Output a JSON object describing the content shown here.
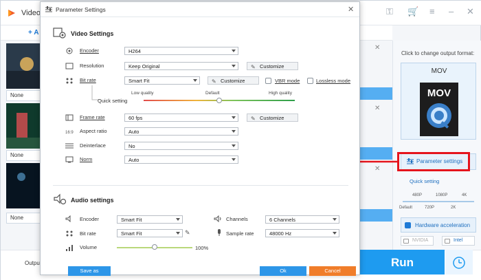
{
  "app": {
    "title": "Video",
    "add_label": "+ A",
    "thumb_labels": [
      "None",
      "None",
      "None"
    ],
    "output_label": "Output",
    "run_label": "Run"
  },
  "sidebar": {
    "format_hint": "Click to change output format:",
    "format_name": "MOV",
    "param_button": "Parameter settings",
    "quick_setting": "Quick setting",
    "quick_ticks_top": [
      "480P",
      "1080P",
      "4K"
    ],
    "quick_ticks_bottom": [
      "Default",
      "720P",
      "2K"
    ],
    "hw_accel": "Hardware acceleration",
    "gpu_nvidia": "NVIDIA",
    "gpu_intel": "Intel"
  },
  "dialog": {
    "title": "Parameter Settings",
    "video_section": "Video Settings",
    "audio_section": "Audio settings",
    "video": {
      "encoder_label": "Encoder",
      "encoder_value": "H264",
      "resolution_label": "Resolution",
      "resolution_value": "Keep Original",
      "bitrate_label": "Bit rate",
      "bitrate_value": "Smart Fit",
      "vbr_label": "VBR mode",
      "lossless_label": "Lossless mode",
      "quick_setting_label": "Quick setting",
      "quality_low": "Low quality",
      "quality_default": "Default",
      "quality_high": "High quality",
      "quality_level": 0.5,
      "framerate_label": "Frame rate",
      "framerate_value": "60 fps",
      "aspect_label": "Aspect ratio",
      "aspect_value": "Auto",
      "deinterlace_label": "Deinterlace",
      "deinterlace_value": "No",
      "norm_label": "Norm",
      "norm_value": "Auto",
      "customize_label": "Customize"
    },
    "audio": {
      "encoder_label": "Encoder",
      "encoder_value": "Smart Fit",
      "channels_label": "Channels",
      "channels_value": "6 Channels",
      "bitrate_label": "Bit rate",
      "bitrate_value": "Smart Fit",
      "samplerate_label": "Sample rate",
      "samplerate_value": "48000 Hz",
      "volume_label": "Volume",
      "volume_value": "100%",
      "volume_level": 0.5
    },
    "save_label": "Save as",
    "ok_label": "Ok",
    "cancel_label": "Cancel"
  },
  "colors": {
    "accent": "#2d96e8",
    "cancel": "#f07d2a",
    "highlight": "#e5141c",
    "run": "#1e9bf0"
  }
}
